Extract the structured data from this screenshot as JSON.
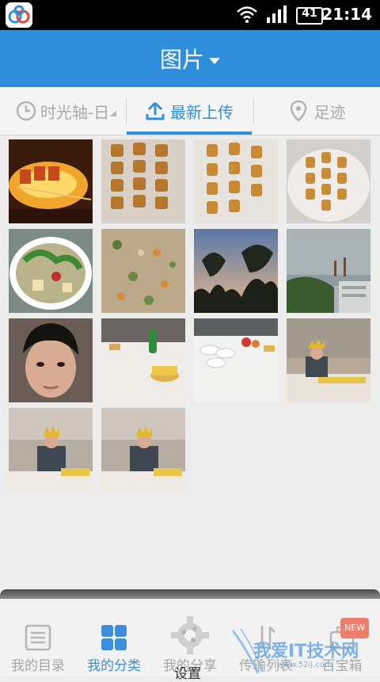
{
  "status_bar": {
    "time": "21:14",
    "battery": "41"
  },
  "header": {
    "title": "图片"
  },
  "tabs": [
    {
      "label": "时光轴-日"
    },
    {
      "label": "最新上传"
    },
    {
      "label": "足迹"
    }
  ],
  "photos": [
    {
      "subject": "oven skewers"
    },
    {
      "subject": "grilled skewers"
    },
    {
      "subject": "grilled skewers"
    },
    {
      "subject": "grilled skewers on plate"
    },
    {
      "subject": "vegetable soup"
    },
    {
      "subject": "stew"
    },
    {
      "subject": "trees at dusk"
    },
    {
      "subject": "harbor skyline"
    },
    {
      "subject": "selfie"
    },
    {
      "subject": "birthday table"
    },
    {
      "subject": "plates on table"
    },
    {
      "subject": "birthday crown"
    },
    {
      "subject": "birthday crown"
    },
    {
      "subject": "birthday crown"
    }
  ],
  "bottom_nav": [
    {
      "label": "我的目录"
    },
    {
      "label": "我的分享_hidden"
    },
    {
      "label": "我的分类"
    },
    {
      "label": "我的分享"
    },
    {
      "label": "传输列表"
    },
    {
      "label": "百宝箱"
    }
  ],
  "settings": {
    "label": "设置"
  },
  "new_badge": "NEW",
  "watermark": {
    "text": "我爱IT技术网",
    "url": "www.52ij.com"
  },
  "colors": {
    "accent": "#2f8fdc",
    "inactive": "#a9a9a9"
  }
}
